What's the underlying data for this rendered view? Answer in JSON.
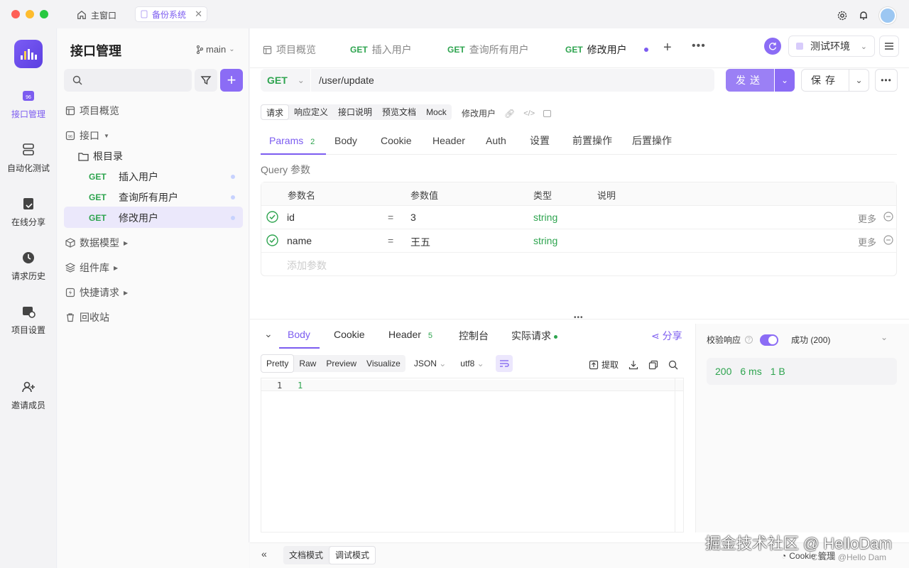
{
  "titlebar": {
    "tab_home": "主窗口",
    "tab_backup": "备份系统"
  },
  "rail": {
    "items": [
      {
        "label": "接口管理",
        "icon": "api-icon",
        "active": true
      },
      {
        "label": "自动化测试",
        "icon": "automation-icon"
      },
      {
        "label": "在线分享",
        "icon": "share-doc-icon"
      },
      {
        "label": "请求历史",
        "icon": "history-icon"
      },
      {
        "label": "项目设置",
        "icon": "settings-icon"
      },
      {
        "label": "邀请成员",
        "icon": "add-user-icon"
      }
    ]
  },
  "sidebar": {
    "title": "接口管理",
    "branch": "main",
    "tree": {
      "overview": "项目概览",
      "api": "接口",
      "root": "根目录",
      "endpoints": [
        {
          "method": "GET",
          "name": "插入用户"
        },
        {
          "method": "GET",
          "name": "查询所有用户"
        },
        {
          "method": "GET",
          "name": "修改用户"
        }
      ],
      "data_model": "数据模型",
      "components": "组件库",
      "quick_request": "快捷请求",
      "trash": "回收站"
    }
  },
  "top_tabs": {
    "overview": "项目概览",
    "tabs": [
      {
        "method": "GET",
        "name": "插入用户"
      },
      {
        "method": "GET",
        "name": "查询所有用户"
      },
      {
        "method": "GET",
        "name": "修改用户"
      }
    ],
    "env": "测试环境"
  },
  "request": {
    "method": "GET",
    "url": "/user/update",
    "send": "发送",
    "save": "保存"
  },
  "subtabs": [
    "请求",
    "响应定义",
    "接口说明",
    "预览文档",
    "Mock"
  ],
  "subtab_name": "修改用户",
  "param_tabs": {
    "params": "Params",
    "params_count": "2",
    "body": "Body",
    "cookie": "Cookie",
    "header": "Header",
    "auth": "Auth",
    "settings": "设置",
    "pre": "前置操作",
    "post": "后置操作"
  },
  "query": {
    "label": "Query 参数",
    "headers": {
      "name": "参数名",
      "value": "参数值",
      "type": "类型",
      "desc": "说明"
    },
    "rows": [
      {
        "name": "id",
        "eq": "=",
        "value": "3",
        "type": "string",
        "more": "更多"
      },
      {
        "name": "name",
        "eq": "=",
        "value": "王五",
        "type": "string",
        "more": "更多"
      }
    ],
    "add_placeholder": "添加参数"
  },
  "response": {
    "tabs": {
      "body": "Body",
      "cookie": "Cookie",
      "header": "Header",
      "header_count": "5",
      "console": "控制台",
      "actual": "实际请求"
    },
    "share": "分享",
    "formats": [
      "Pretty",
      "Raw",
      "Preview",
      "Visualize"
    ],
    "lang": "JSON",
    "encoding": "utf8",
    "extract": "提取",
    "line_no": "1",
    "line_content": "1",
    "validate": "校验响应",
    "status_text": "成功 (200)",
    "status": "200",
    "time": "6 ms",
    "size": "1 B"
  },
  "bottom": {
    "doc_mode": "文档模式",
    "debug_mode": "调试模式",
    "cookie_mgmt": "Cookie 管理"
  },
  "watermark": {
    "line1": "掘金技术社区 @ HelloDam",
    "line2": "CSDN @Hello Dam"
  },
  "colors": {
    "accent": "#7c5cf0",
    "get": "#2ea44f"
  }
}
